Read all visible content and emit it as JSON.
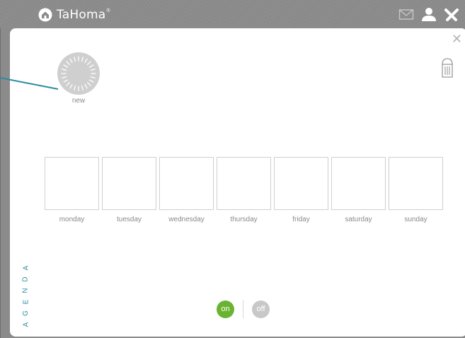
{
  "app": {
    "brand": "TaHoma",
    "brand_mark": "®"
  },
  "header_icons": [
    "mail-icon",
    "user-icon",
    "tools-icon"
  ],
  "scenario": {
    "name": "new",
    "icon": "clock-dial-icon"
  },
  "days": [
    {
      "label": "monday"
    },
    {
      "label": "tuesday"
    },
    {
      "label": "wednesday"
    },
    {
      "label": "thursday"
    },
    {
      "label": "friday"
    },
    {
      "label": "saturday"
    },
    {
      "label": "sunday"
    }
  ],
  "side_tab": {
    "letters": [
      "A",
      "G",
      "E",
      "N",
      "D",
      "A"
    ]
  },
  "toggle": {
    "on_label": "on",
    "off_label": "off",
    "active": "on"
  },
  "colors": {
    "accent": "#2b8da3",
    "on": "#6ab331",
    "off": "#c8c8c8"
  }
}
